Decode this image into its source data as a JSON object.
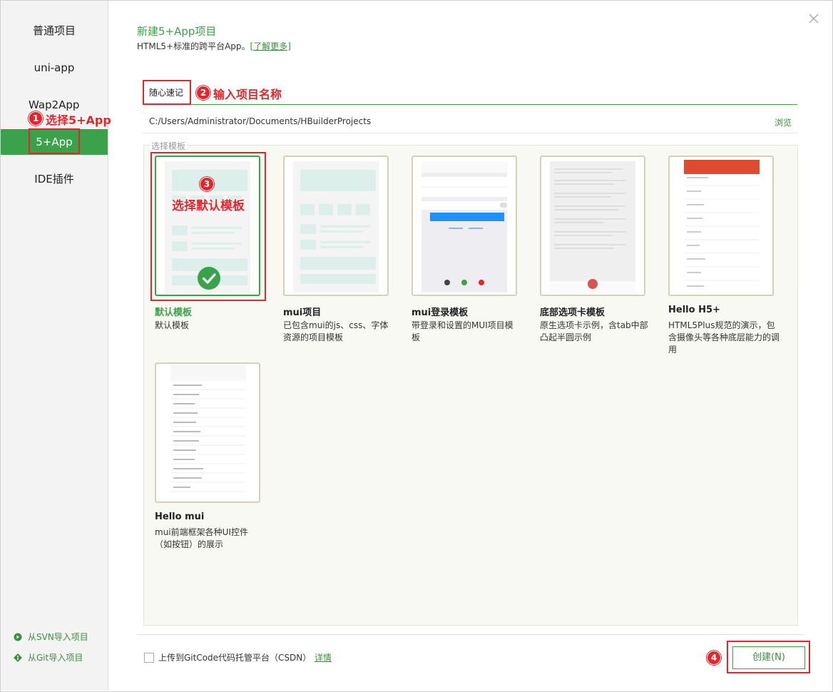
{
  "colors": {
    "accent": "#3aa24a",
    "annotation": "#e3262b"
  },
  "sidebar": {
    "items": [
      {
        "label": "普通项目"
      },
      {
        "label": "uni-app"
      },
      {
        "label": "Wap2App"
      },
      {
        "label": "5+App"
      },
      {
        "label": "IDE插件"
      }
    ],
    "imports": [
      {
        "label": "从SVN导入项目",
        "icon": "svn-icon"
      },
      {
        "label": "从Git导入项目",
        "icon": "git-icon"
      }
    ]
  },
  "header": {
    "title": "新建5+App项目",
    "subtitle": "HTML5+标准的跨平台App。",
    "learn_more": "[了解更多]"
  },
  "form": {
    "project_name": "随心速记",
    "path": "C:/Users/Administrator/Documents/HBuilderProjects",
    "browse": "浏览"
  },
  "templates": {
    "legend": "选择模板",
    "items": [
      {
        "title": "默认模板",
        "desc": "默认模板",
        "selected": true
      },
      {
        "title": "mui项目",
        "desc": "已包含mui的js、css、字体资源的项目模板"
      },
      {
        "title": "mui登录模板",
        "desc": "带登录和设置的MUI项目模板"
      },
      {
        "title": "底部选项卡模板",
        "desc": "原生选项卡示例，含tab中部凸起半圆示例"
      },
      {
        "title": "Hello H5+",
        "desc": "HTML5Plus规范的演示，包含摄像头等各种底层能力的调用"
      },
      {
        "title": "Hello mui",
        "desc": "mui前端框架各种UI控件（如按钮）的展示"
      }
    ]
  },
  "footer": {
    "upload_label": "上传到GitCode代码托管平台（CSDN）",
    "detail": "详情",
    "create": "创建(N)"
  },
  "annotations": [
    {
      "num": "1",
      "text": "选择5+App"
    },
    {
      "num": "2",
      "text": "输入项目名称"
    },
    {
      "num": "3",
      "text": "选择默认模板"
    },
    {
      "num": "4"
    }
  ]
}
